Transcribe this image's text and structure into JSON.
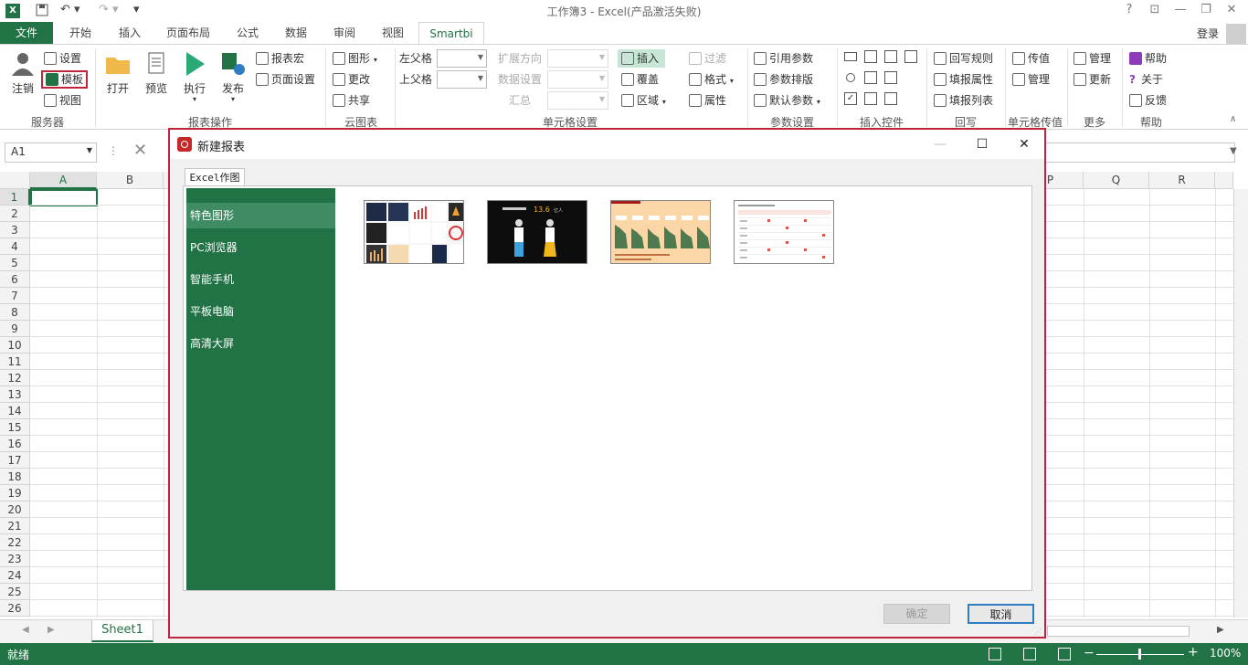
{
  "window": {
    "title": "工作簿3 - Excel(产品激活失败)",
    "login": "登录"
  },
  "tabs": [
    {
      "label": "文件"
    },
    {
      "label": "开始"
    },
    {
      "label": "插入"
    },
    {
      "label": "页面布局"
    },
    {
      "label": "公式"
    },
    {
      "label": "数据"
    },
    {
      "label": "审阅"
    },
    {
      "label": "视图"
    },
    {
      "label": "Smartbi"
    }
  ],
  "ribbon": {
    "server": {
      "logout": "注销",
      "settings": "设置",
      "template": "模板",
      "view": "视图",
      "label": "服务器"
    },
    "report_ops": {
      "open": "打开",
      "preview": "预览",
      "execute": "执行",
      "publish": "发布",
      "report_macro": "报表宏",
      "page_setup": "页面设置",
      "label": "报表操作"
    },
    "cloud": {
      "chart": "图形",
      "change": "更改",
      "share": "共享",
      "label": "云图表"
    },
    "cell_settings": {
      "left_parent": "左父格",
      "upper_parent": "上父格",
      "expand_dir": "扩展方向",
      "data_settings": "数据设置",
      "summary": "汇总",
      "insert": "插入",
      "overwrite": "覆盖",
      "region": "区域",
      "filter": "过滤",
      "format": "格式",
      "attribute": "属性",
      "label": "单元格设置"
    },
    "params": {
      "ref_param": "引用参数",
      "param_layout": "参数排版",
      "default_param": "默认参数",
      "label": "参数设置"
    },
    "insert_ctrl": {
      "label": "插入控件"
    },
    "writeback": {
      "rules": "回写规则",
      "fill_attr": "填报属性",
      "fill_list": "填报列表",
      "label": "回写"
    },
    "cell_pass": {
      "pass": "传值",
      "manage": "管理",
      "label": "单元格传值"
    },
    "more": {
      "manage": "管理",
      "update": "更新",
      "label": "更多"
    },
    "help": {
      "help": "帮助",
      "about": "关于",
      "feedback": "反馈",
      "label": "帮助"
    }
  },
  "formula_bar": {
    "cell_ref": "A1"
  },
  "grid": {
    "columns_left": [
      "A",
      "B"
    ],
    "columns_right": [
      "P",
      "Q",
      "R"
    ],
    "rows": [
      "1",
      "2",
      "3",
      "4",
      "5",
      "6",
      "7",
      "8",
      "9",
      "10",
      "11",
      "12",
      "13",
      "14",
      "15",
      "16",
      "17",
      "18",
      "19",
      "20",
      "21",
      "22",
      "23",
      "24",
      "25",
      "26"
    ]
  },
  "sheet": {
    "tab": "Sheet1"
  },
  "status": {
    "ready": "就绪",
    "zoom": "100%"
  },
  "dialog": {
    "title": "新建报表",
    "tab": "Excel作图",
    "nav": [
      {
        "label": "特色图形"
      },
      {
        "label": "PC浏览器"
      },
      {
        "label": "智能手机"
      },
      {
        "label": "平板电脑"
      },
      {
        "label": "高清大屏"
      }
    ],
    "thumb2": {
      "num": "13.6",
      "unit": "亿人"
    },
    "ok": "确定",
    "cancel": "取消"
  }
}
